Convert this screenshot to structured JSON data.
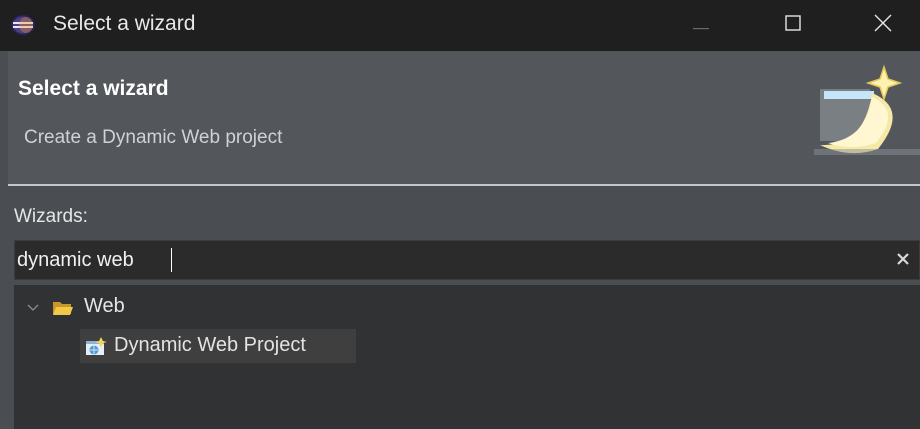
{
  "window": {
    "title": "Select a wizard"
  },
  "header": {
    "title": "Select a wizard",
    "description": "Create a Dynamic Web project"
  },
  "wizards": {
    "label": "Wizards:",
    "filter_value": "dynamic web"
  },
  "tree": {
    "category_label": "Web",
    "item_label": "Dynamic Web Project"
  },
  "icons": {
    "app": "eclipse-icon",
    "minimize": "minimize-icon",
    "maximize": "maximize-icon",
    "close": "close-icon",
    "banner": "wizard-banner-icon",
    "clear": "clear-icon",
    "expand": "chevron-down-icon",
    "folder": "folder-open-icon",
    "project": "dynamic-web-project-icon"
  },
  "colors": {
    "titlebar": "#1f1f1f",
    "header": "#53575c",
    "body": "#4a4e53",
    "input": "#2b2b2b",
    "tree": "#313233",
    "selection": "#3f3f3f",
    "folder": "#f0c24a"
  }
}
